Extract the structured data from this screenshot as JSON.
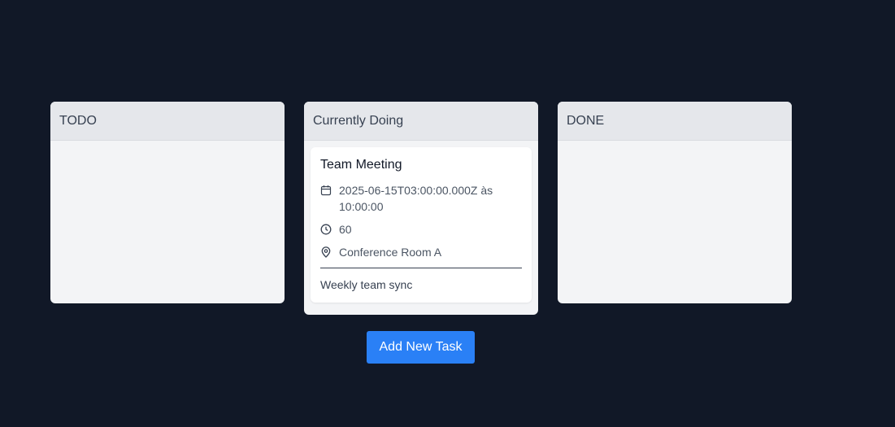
{
  "columns": [
    {
      "title": "TODO",
      "tasks": []
    },
    {
      "title": "Currently Doing",
      "tasks": [
        {
          "title": "Team Meeting",
          "datetime": "2025-06-15T03:00:00.000Z às 10:00:00",
          "duration": "60",
          "location": "Conference Room A",
          "description": "Weekly team sync",
          "icons": [
            "calendar-icon",
            "clock-icon",
            "map-pin-icon"
          ]
        }
      ]
    },
    {
      "title": "DONE",
      "tasks": []
    }
  ],
  "add_task_label": "Add New Task",
  "colors": {
    "background": "#111827",
    "column": "#f3f4f6",
    "column_header": "#e5e7eb",
    "card": "#ffffff",
    "accent_button": "#2a80f6"
  }
}
